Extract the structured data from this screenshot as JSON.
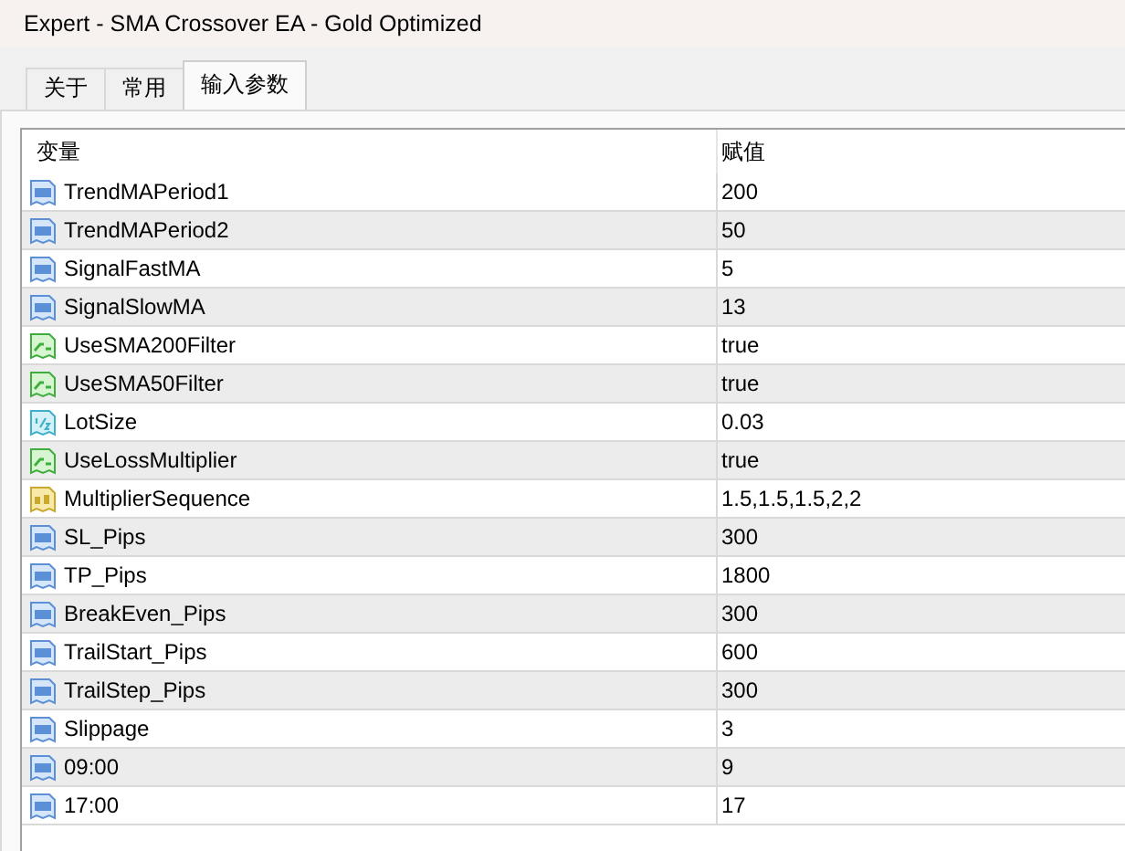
{
  "window": {
    "title": "Expert - SMA Crossover EA - Gold Optimized"
  },
  "tabs": [
    {
      "label": "关于",
      "selected": false
    },
    {
      "label": "常用",
      "selected": false
    },
    {
      "label": "输入参数",
      "selected": true
    }
  ],
  "table": {
    "columns": [
      "变量",
      "赋值"
    ],
    "rows": [
      {
        "kind": "int",
        "name": "TrendMAPeriod1",
        "value": "200"
      },
      {
        "kind": "int",
        "name": "TrendMAPeriod2",
        "value": "50"
      },
      {
        "kind": "int",
        "name": "SignalFastMA",
        "value": "5"
      },
      {
        "kind": "int",
        "name": "SignalSlowMA",
        "value": "13"
      },
      {
        "kind": "bool",
        "name": "UseSMA200Filter",
        "value": "true"
      },
      {
        "kind": "bool",
        "name": "UseSMA50Filter",
        "value": "true"
      },
      {
        "kind": "double",
        "name": "LotSize",
        "value": "0.03"
      },
      {
        "kind": "bool",
        "name": "UseLossMultiplier",
        "value": "true"
      },
      {
        "kind": "string",
        "name": "MultiplierSequence",
        "value": "1.5,1.5,1.5,2,2"
      },
      {
        "kind": "int",
        "name": "SL_Pips",
        "value": "300"
      },
      {
        "kind": "int",
        "name": "TP_Pips",
        "value": "1800"
      },
      {
        "kind": "int",
        "name": "BreakEven_Pips",
        "value": "300"
      },
      {
        "kind": "int",
        "name": "TrailStart_Pips",
        "value": "600"
      },
      {
        "kind": "int",
        "name": "TrailStep_Pips",
        "value": "300"
      },
      {
        "kind": "int",
        "name": "Slippage",
        "value": "3"
      },
      {
        "kind": "int",
        "name": "09:00",
        "value": "9"
      },
      {
        "kind": "int",
        "name": "17:00",
        "value": "17"
      }
    ]
  }
}
